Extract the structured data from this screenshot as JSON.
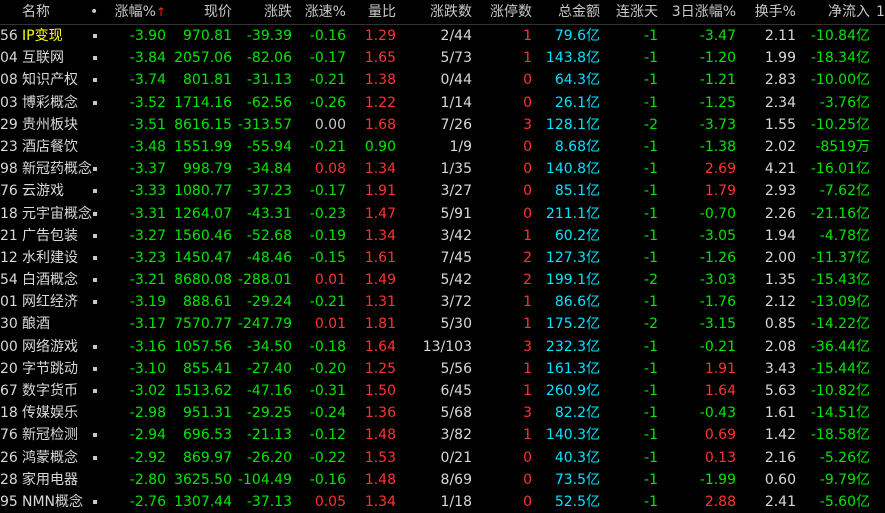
{
  "header": {
    "name": "名称",
    "dot": "•",
    "pct": "涨幅%",
    "sort_arrow": "↑",
    "price": "现价",
    "change": "涨跌",
    "speed": "涨速%",
    "ratio": "量比",
    "updown": "涨跌数",
    "limitup": "涨停数",
    "amount": "总金额",
    "streak": "连涨天",
    "pct3": "3日涨幅%",
    "turnover": "换手%",
    "inflow": "净流入",
    "extra": "1"
  },
  "rows": [
    {
      "code": "56",
      "name": "IP变现",
      "mark": true,
      "pct": "-3.90",
      "price": "970.81",
      "change": "-39.39",
      "speed": "-0.16",
      "ratio": "1.29",
      "updown": "2/44",
      "limit": "1",
      "amt": "79.6",
      "unit": "亿",
      "streak": "-1",
      "pct3": "-3.47",
      "turn": "2.11",
      "inflow": "-10.84亿",
      "sel": true
    },
    {
      "code": "04",
      "name": "互联网",
      "mark": true,
      "pct": "-3.84",
      "price": "2057.06",
      "change": "-82.06",
      "speed": "-0.17",
      "ratio": "1.65",
      "updown": "5/73",
      "limit": "1",
      "amt": "143.8",
      "unit": "亿",
      "streak": "-1",
      "pct3": "-1.20",
      "turn": "1.99",
      "inflow": "-18.34亿"
    },
    {
      "code": "08",
      "name": "知识产权",
      "mark": true,
      "pct": "-3.74",
      "price": "801.81",
      "change": "-31.13",
      "speed": "-0.21",
      "ratio": "1.38",
      "updown": "0/44",
      "limit": "0",
      "amt": "64.3",
      "unit": "亿",
      "streak": "-1",
      "pct3": "-1.21",
      "turn": "2.83",
      "inflow": "-10.00亿"
    },
    {
      "code": "03",
      "name": "博彩概念",
      "mark": true,
      "pct": "-3.52",
      "price": "1714.16",
      "change": "-62.56",
      "speed": "-0.26",
      "ratio": "1.22",
      "updown": "1/14",
      "limit": "0",
      "amt": "26.1",
      "unit": "亿",
      "streak": "-1",
      "pct3": "-1.25",
      "turn": "2.34",
      "inflow": "-3.76亿"
    },
    {
      "code": "29",
      "name": "贵州板块",
      "mark": false,
      "pct": "-3.51",
      "price": "8616.15",
      "change": "-313.57",
      "speed": "0.00",
      "ratio": "1.68",
      "updown": "7/26",
      "limit": "3",
      "amt": "128.1",
      "unit": "亿",
      "streak": "-2",
      "pct3": "-3.73",
      "turn": "1.55",
      "inflow": "-10.25亿"
    },
    {
      "code": "23",
      "name": "酒店餐饮",
      "mark": false,
      "pct": "-3.48",
      "price": "1551.99",
      "change": "-55.94",
      "speed": "-0.21",
      "ratio": "0.90",
      "updown": "1/9",
      "limit": "0",
      "amt": "8.68",
      "unit": "亿",
      "streak": "-1",
      "pct3": "-1.38",
      "turn": "2.02",
      "inflow": "-8519万"
    },
    {
      "code": "98",
      "name": "新冠药概念",
      "mark": true,
      "pct": "-3.37",
      "price": "998.79",
      "change": "-34.84",
      "speed": "0.08",
      "ratio": "1.34",
      "updown": "1/35",
      "limit": "0",
      "amt": "140.8",
      "unit": "亿",
      "streak": "-1",
      "pct3": "2.69",
      "turn": "4.21",
      "inflow": "-16.01亿"
    },
    {
      "code": "76",
      "name": "云游戏",
      "mark": true,
      "pct": "-3.33",
      "price": "1080.77",
      "change": "-37.23",
      "speed": "-0.17",
      "ratio": "1.91",
      "updown": "3/27",
      "limit": "0",
      "amt": "85.1",
      "unit": "亿",
      "streak": "-1",
      "pct3": "1.79",
      "turn": "2.93",
      "inflow": "-7.62亿"
    },
    {
      "code": "18",
      "name": "元宇宙概念",
      "mark": true,
      "pct": "-3.31",
      "price": "1264.07",
      "change": "-43.31",
      "speed": "-0.23",
      "ratio": "1.47",
      "updown": "5/91",
      "limit": "0",
      "amt": "211.1",
      "unit": "亿",
      "streak": "-1",
      "pct3": "-0.70",
      "turn": "2.26",
      "inflow": "-21.16亿"
    },
    {
      "code": "21",
      "name": "广告包装",
      "mark": true,
      "pct": "-3.27",
      "price": "1560.46",
      "change": "-52.68",
      "speed": "-0.19",
      "ratio": "1.34",
      "updown": "3/42",
      "limit": "1",
      "amt": "60.2",
      "unit": "亿",
      "streak": "-1",
      "pct3": "-3.05",
      "turn": "1.94",
      "inflow": "-4.78亿"
    },
    {
      "code": "12",
      "name": "水利建设",
      "mark": true,
      "pct": "-3.23",
      "price": "1450.47",
      "change": "-48.46",
      "speed": "-0.15",
      "ratio": "1.61",
      "updown": "7/45",
      "limit": "2",
      "amt": "127.3",
      "unit": "亿",
      "streak": "-1",
      "pct3": "-1.26",
      "turn": "2.00",
      "inflow": "-11.37亿"
    },
    {
      "code": "54",
      "name": "白酒概念",
      "mark": true,
      "pct": "-3.21",
      "price": "8680.08",
      "change": "-288.01",
      "speed": "0.01",
      "ratio": "1.49",
      "updown": "5/42",
      "limit": "2",
      "amt": "199.1",
      "unit": "亿",
      "streak": "-2",
      "pct3": "-3.03",
      "turn": "1.35",
      "inflow": "-15.43亿"
    },
    {
      "code": "01",
      "name": "网红经济",
      "mark": true,
      "pct": "-3.19",
      "price": "888.61",
      "change": "-29.24",
      "speed": "-0.21",
      "ratio": "1.31",
      "updown": "3/72",
      "limit": "1",
      "amt": "86.6",
      "unit": "亿",
      "streak": "-1",
      "pct3": "-1.76",
      "turn": "2.12",
      "inflow": "-13.09亿"
    },
    {
      "code": "30",
      "name": "酿酒",
      "mark": false,
      "pct": "-3.17",
      "price": "7570.77",
      "change": "-247.79",
      "speed": "0.01",
      "ratio": "1.81",
      "updown": "5/30",
      "limit": "1",
      "amt": "175.2",
      "unit": "亿",
      "streak": "-2",
      "pct3": "-3.15",
      "turn": "0.85",
      "inflow": "-14.22亿"
    },
    {
      "code": "00",
      "name": "网络游戏",
      "mark": true,
      "pct": "-3.16",
      "price": "1057.56",
      "change": "-34.50",
      "speed": "-0.18",
      "ratio": "1.64",
      "updown": "13/103",
      "limit": "3",
      "amt": "232.3",
      "unit": "亿",
      "streak": "-1",
      "pct3": "-0.21",
      "turn": "2.08",
      "inflow": "-36.44亿"
    },
    {
      "code": "20",
      "name": "字节跳动",
      "mark": true,
      "pct": "-3.10",
      "price": "855.41",
      "change": "-27.40",
      "speed": "-0.20",
      "ratio": "1.25",
      "updown": "5/56",
      "limit": "1",
      "amt": "161.3",
      "unit": "亿",
      "streak": "-1",
      "pct3": "1.91",
      "turn": "3.43",
      "inflow": "-15.44亿"
    },
    {
      "code": "67",
      "name": "数字货币",
      "mark": true,
      "pct": "-3.02",
      "price": "1513.62",
      "change": "-47.16",
      "speed": "-0.31",
      "ratio": "1.50",
      "updown": "6/45",
      "limit": "1",
      "amt": "260.9",
      "unit": "亿",
      "streak": "-1",
      "pct3": "1.64",
      "turn": "5.63",
      "inflow": "-10.82亿"
    },
    {
      "code": "18",
      "name": "传媒娱乐",
      "mark": false,
      "pct": "-2.98",
      "price": "951.31",
      "change": "-29.25",
      "speed": "-0.24",
      "ratio": "1.36",
      "updown": "5/68",
      "limit": "3",
      "amt": "82.2",
      "unit": "亿",
      "streak": "-1",
      "pct3": "-0.43",
      "turn": "1.61",
      "inflow": "-14.51亿"
    },
    {
      "code": "76",
      "name": "新冠检测",
      "mark": true,
      "pct": "-2.94",
      "price": "696.53",
      "change": "-21.13",
      "speed": "-0.12",
      "ratio": "1.48",
      "updown": "3/82",
      "limit": "1",
      "amt": "140.3",
      "unit": "亿",
      "streak": "-1",
      "pct3": "0.69",
      "turn": "1.42",
      "inflow": "-18.58亿"
    },
    {
      "code": "26",
      "name": "鸿蒙概念",
      "mark": true,
      "pct": "-2.92",
      "price": "869.97",
      "change": "-26.20",
      "speed": "-0.22",
      "ratio": "1.53",
      "updown": "0/21",
      "limit": "0",
      "amt": "40.3",
      "unit": "亿",
      "streak": "-1",
      "pct3": "0.13",
      "turn": "2.16",
      "inflow": "-5.26亿"
    },
    {
      "code": "28",
      "name": "家用电器",
      "mark": false,
      "pct": "-2.80",
      "price": "3625.50",
      "change": "-104.49",
      "speed": "-0.16",
      "ratio": "1.48",
      "updown": "8/69",
      "limit": "0",
      "amt": "73.5",
      "unit": "亿",
      "streak": "-1",
      "pct3": "-1.99",
      "turn": "0.60",
      "inflow": "-9.79亿"
    },
    {
      "code": "95",
      "name": "NMN概念",
      "mark": true,
      "pct": "-2.76",
      "price": "1307.44",
      "change": "-37.13",
      "speed": "0.05",
      "ratio": "1.34",
      "updown": "1/18",
      "limit": "0",
      "amt": "52.5",
      "unit": "亿",
      "streak": "-1",
      "pct3": "2.88",
      "turn": "2.41",
      "inflow": "-5.60亿"
    }
  ]
}
